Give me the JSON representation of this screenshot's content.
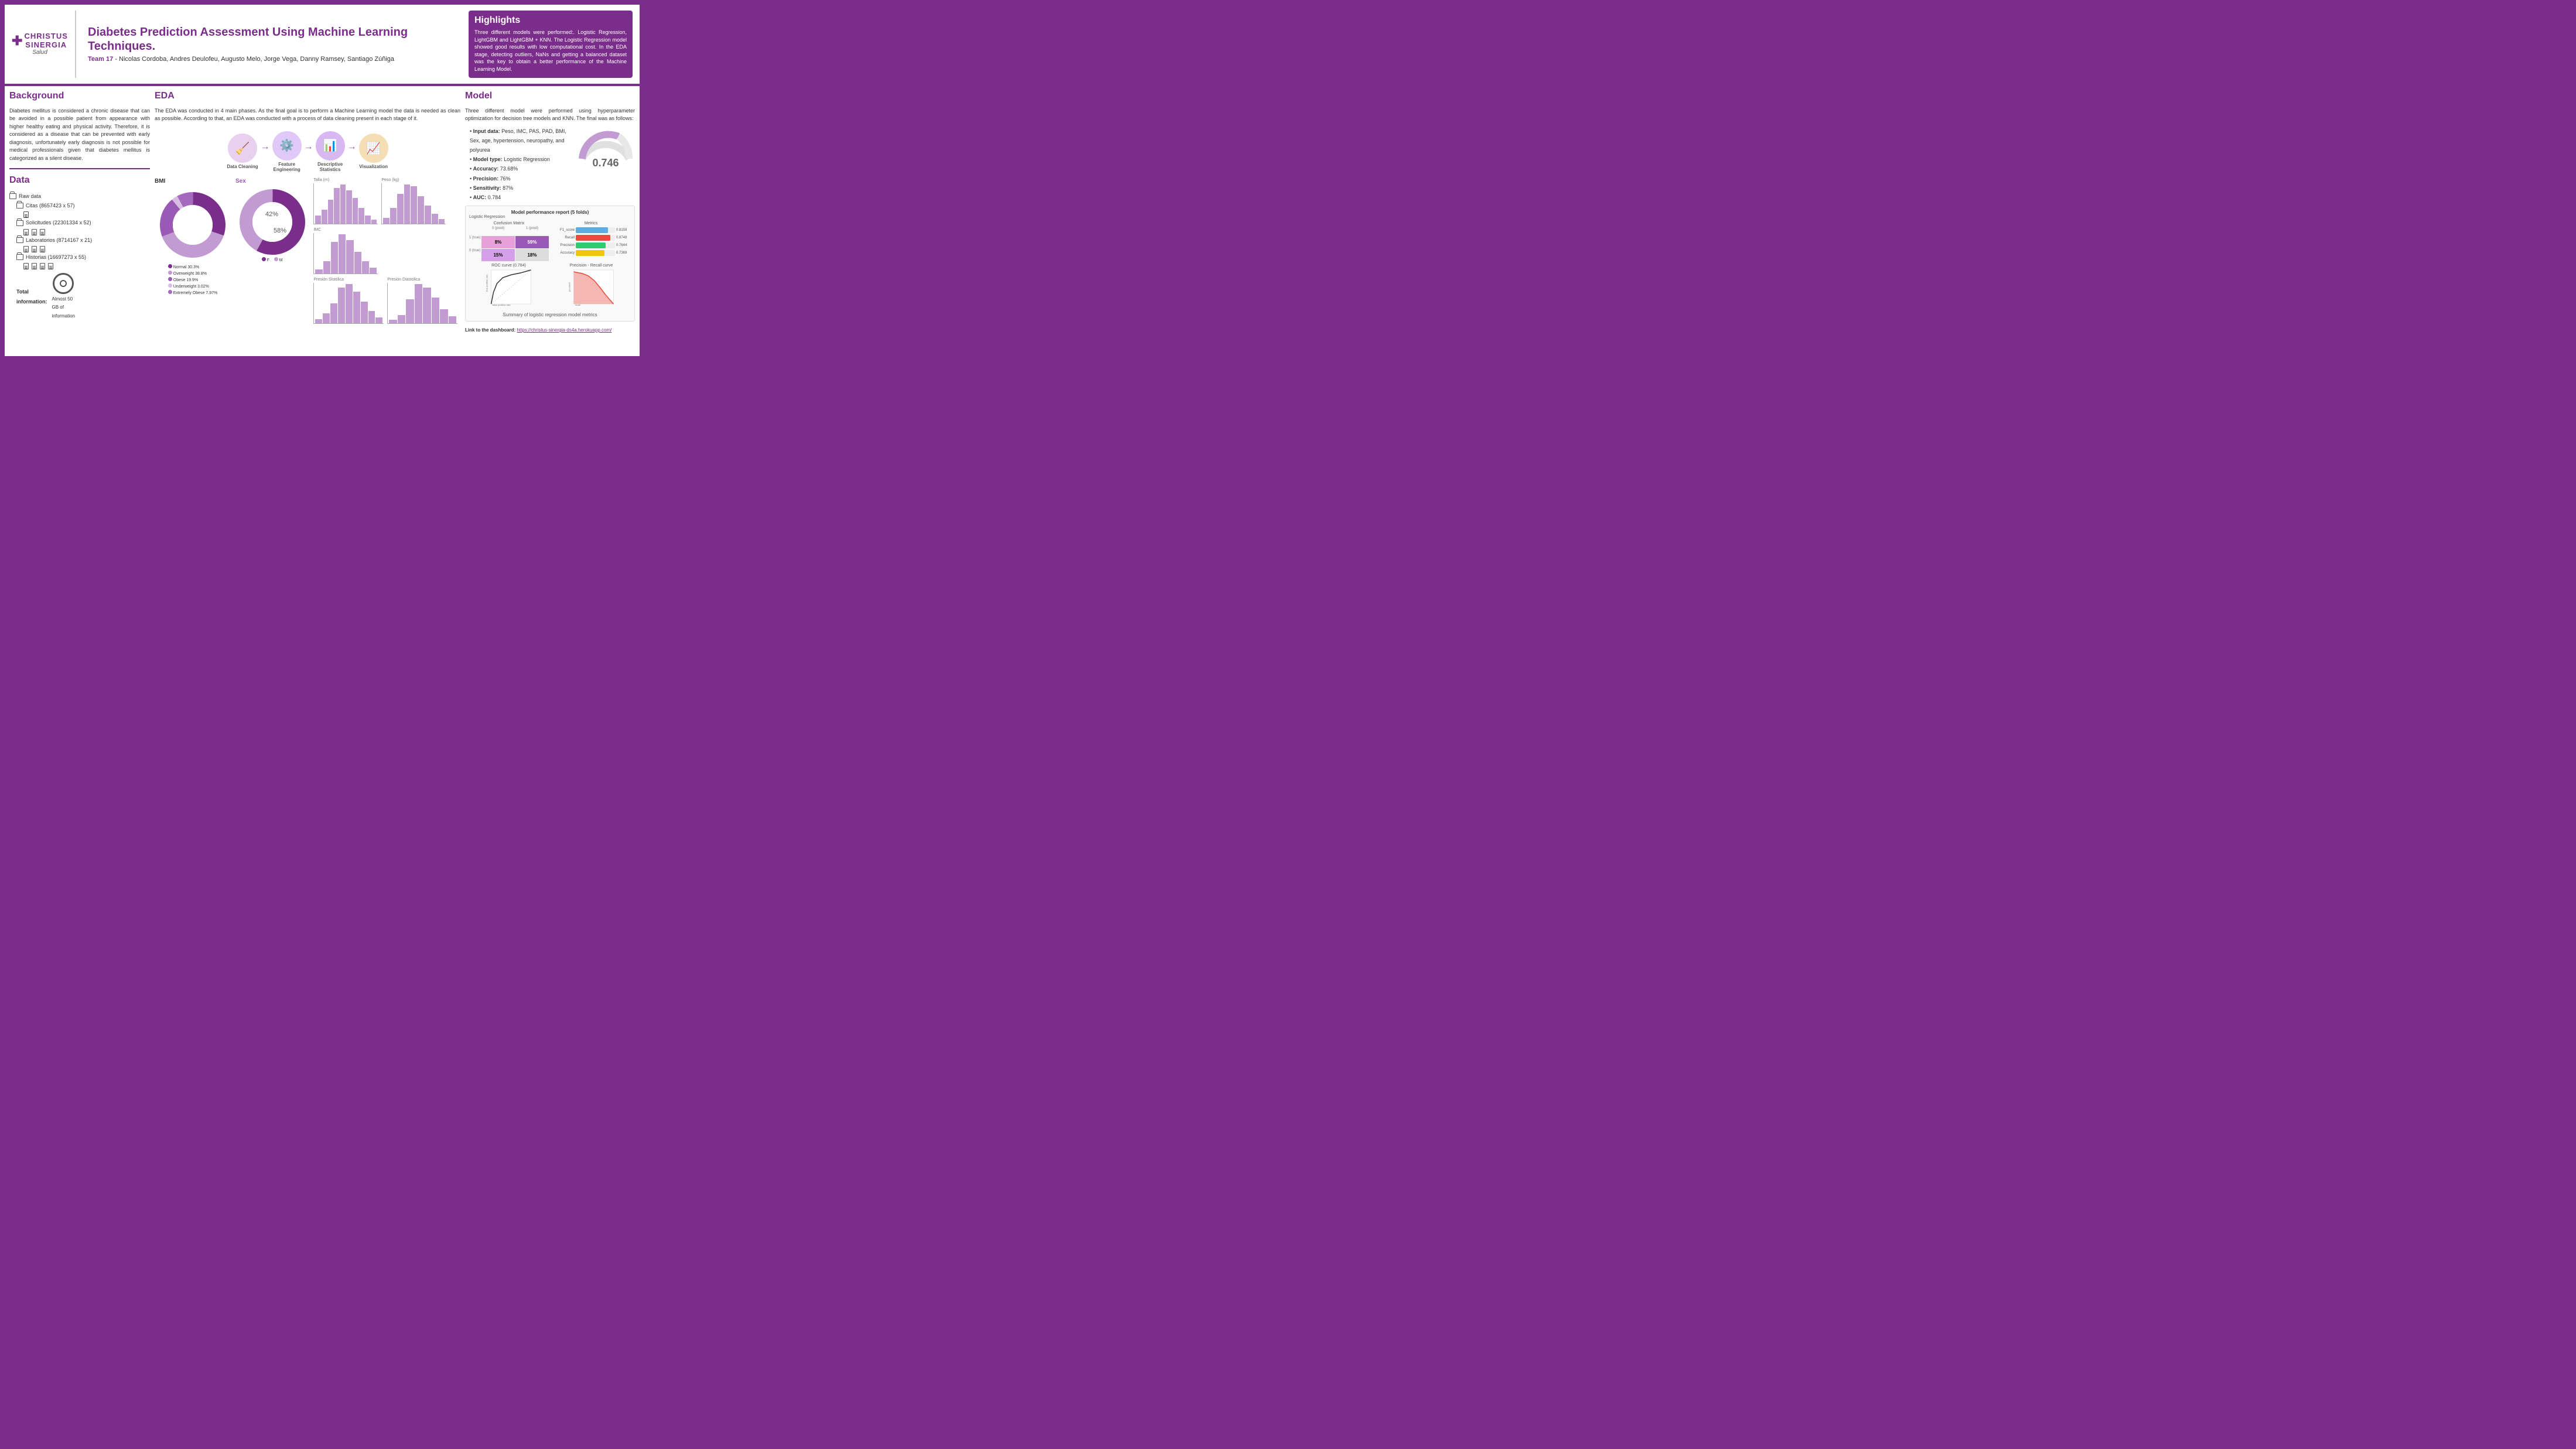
{
  "header": {
    "logo_main": "CHRISTUS\nSINERGIA",
    "logo_sub": "Salud",
    "title": "Diabetes Prediction Assessment Using Machine Learning Techniques.",
    "team_label": "Team 17",
    "team_members": "- Nicolas Cordoba, Andres Deulofeu, Augusto Melo, Jorge Vega, Danny Ramsey, Santiago Zúñiga"
  },
  "highlights": {
    "title": "Highlights",
    "text": "Three different models were performed:. Logistic Regression, LightGBM and LightGBM + KNN. The Logistic Regression model showed good results with low computational cost.\nIn the EDA stage, detecting outliers, NaNs and getting a balanced dataset was the key to obtain a better performance of the Machine Learning Model."
  },
  "background": {
    "title": "Background",
    "text": "Diabetes mellitus is considered  a chronic disease that can be avoided in a possible patient from appearance with higher healthy eating and physical activity. Therefore, it is considered as a disease that can be prevented with early diagnosis, unfortunately early diagnosis is not possible for medical professionals given that diabetes mellitus is categorized as a silent disease."
  },
  "data": {
    "title": "Data",
    "raw_label": "Raw data",
    "folders": [
      {
        "name": "Citas (8657423 x 57)",
        "files": 1
      },
      {
        "name": "Solicitudes (22301334 x 52)",
        "files": 3
      },
      {
        "name": "Laboratorios (8714167 x 21)",
        "files": 3
      },
      {
        "name": "Historias (16697273 x 55)",
        "files": 4
      }
    ],
    "total_label": "Total\ninformation:",
    "total_amount": "Almost 50\nGB of\ninformation"
  },
  "eda": {
    "title": "EDA",
    "text": "The EDA was conducted in 4 main phases. As the final goal is to perform a Machine Learning model the data is needed as clean as possible. According to that, an EDA was conducted with a process of data cleaning present in each stage of it.",
    "pipeline": [
      {
        "label": "Data Cleaning",
        "icon": "🧹",
        "color": "#E8A0D8"
      },
      {
        "label": "Feature\nEngineering",
        "icon": "⚙️",
        "color": "#C39BD3"
      },
      {
        "label": "Descriptive\nStatistics",
        "icon": "📊",
        "color": "#D5A0E8"
      },
      {
        "label": "Visualization",
        "icon": "📈",
        "color": "#E8C09B"
      }
    ],
    "bmi_chart": {
      "title": "BMI",
      "segments": [
        {
          "label": "Normal 30.3%",
          "value": 30.3,
          "color": "#7B2D8B"
        },
        {
          "label": "Overweight 38.8%",
          "value": 38.8,
          "color": "#C39BD3"
        },
        {
          "label": "Obese 19.9%",
          "value": 19.9,
          "color": "#9B59B6"
        },
        {
          "label": "Underweight 3.02%",
          "value": 3.02,
          "color": "#D7BDE2"
        },
        {
          "label": "Extremely Obese 7.97%",
          "value": 7.97,
          "color": "#A569BD"
        }
      ]
    },
    "sex_chart": {
      "title": "Sex",
      "segments": [
        {
          "label": "F",
          "value": 58,
          "color": "#7B2D8B"
        },
        {
          "label": "M",
          "value": 42,
          "color": "#C39BD3"
        }
      ]
    }
  },
  "model": {
    "title": "Model",
    "text": "Three different model were performed using hyperparameter optimization for decision tree models and KNN. The final was as follows:",
    "bullets": [
      {
        "key": "Input data:",
        "value": "Peso, IMC, PAS, PAD, BMI, Sex, age, hypertension, neuropathy, and polyurea"
      },
      {
        "key": "Model type:",
        "value": "Logistic Regression"
      },
      {
        "key": "Accuracy:",
        "value": "73.68%"
      },
      {
        "key": "Precision:",
        "value": "76%"
      },
      {
        "key": "Sensitivity:",
        "value": "87%"
      },
      {
        "key": "AUC:",
        "value": "0.784"
      }
    ],
    "gauge_value": "0.746",
    "performance_title": "Model performance report (5 folds)",
    "logistic_label": "Logistic Regression",
    "confusion_matrix": {
      "title": "Confusion Matrix",
      "cells": [
        {
          "label": "8%",
          "bg": "#E8A0D8"
        },
        {
          "label": "59%",
          "bg": "#9B59B6"
        },
        {
          "label": "15%",
          "bg": "#D5A0E8"
        },
        {
          "label": "18%",
          "bg": "#DDDDDD"
        }
      ]
    },
    "metrics": {
      "title": "Metrics",
      "items": [
        {
          "label": "F1_score",
          "value": 0.8159,
          "display": "0.8159",
          "color": "#5DADE2"
        },
        {
          "label": "Recall",
          "value": 0.8748,
          "display": "0.8748",
          "color": "#E74C3C"
        },
        {
          "label": "Precision",
          "value": 0.7644,
          "display": "0.7644",
          "color": "#2ECC71"
        },
        {
          "label": "Accuracy",
          "value": 0.7369,
          "display": "0.7369",
          "color": "#F1C40F"
        }
      ]
    },
    "roc_title": "ROC curve (0.784)",
    "pr_title": "Precision - Recall curve",
    "summary": "Summary of logistic regression model metrics",
    "dashboard_label": "Link to the dashboard:",
    "dashboard_url": "https://christus-sinergia-ds4a.herokuapp.com/"
  }
}
